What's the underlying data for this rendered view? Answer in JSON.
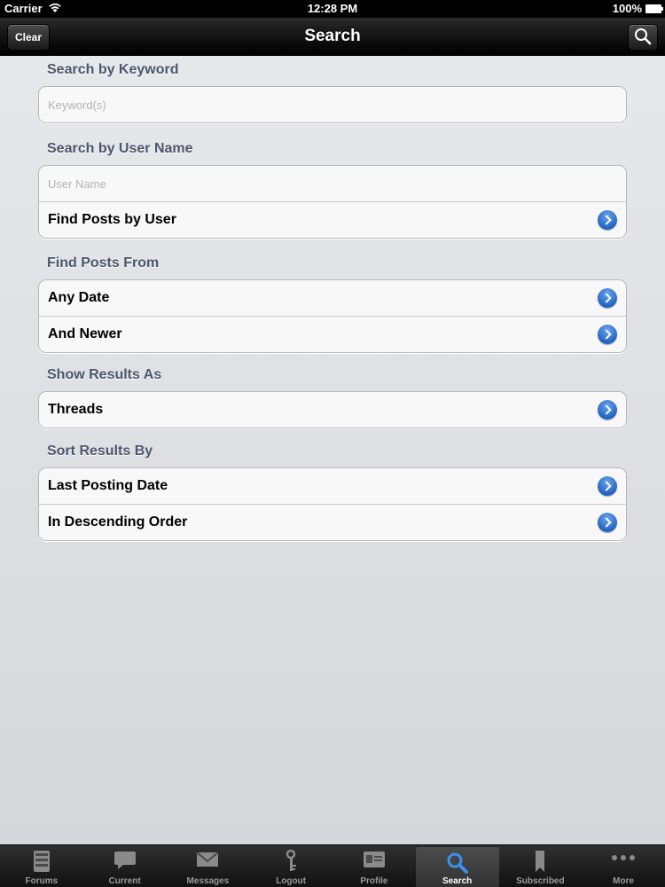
{
  "status_bar": {
    "carrier": "Carrier",
    "time": "12:28 PM",
    "battery": "100%"
  },
  "nav_bar": {
    "title": "Search",
    "clear_label": "Clear"
  },
  "keyword": {
    "header": "Search by Keyword",
    "placeholder": "Keyword(s)"
  },
  "user": {
    "header": "Search by User Name",
    "placeholder": "User Name",
    "find_posts_label": "Find Posts by User"
  },
  "posts_from": {
    "header": "Find Posts From",
    "date_label": "Any Date",
    "newer_label": "And Newer"
  },
  "results_as": {
    "header": "Show Results As",
    "threads_label": "Threads"
  },
  "sort_by": {
    "header": "Sort Results By",
    "field_label": "Last Posting Date",
    "order_label": "In Descending Order"
  },
  "tab_bar": {
    "selected": "Search",
    "tabs": [
      {
        "label": "Forums",
        "icon": "forums-icon"
      },
      {
        "label": "Current",
        "icon": "speech-bubble-icon"
      },
      {
        "label": "Messages",
        "icon": "envelope-icon"
      },
      {
        "label": "Logout",
        "icon": "key-icon"
      },
      {
        "label": "Profile",
        "icon": "id-card-icon"
      },
      {
        "label": "Search",
        "icon": "search-icon"
      },
      {
        "label": "Subscribed",
        "icon": "bookmark-icon"
      },
      {
        "label": "More",
        "icon": "more-dots-icon"
      }
    ]
  },
  "colors": {
    "section_header": "#4c566c",
    "disclosure": "#2463c4",
    "placeholder": "#b3b3b3"
  }
}
